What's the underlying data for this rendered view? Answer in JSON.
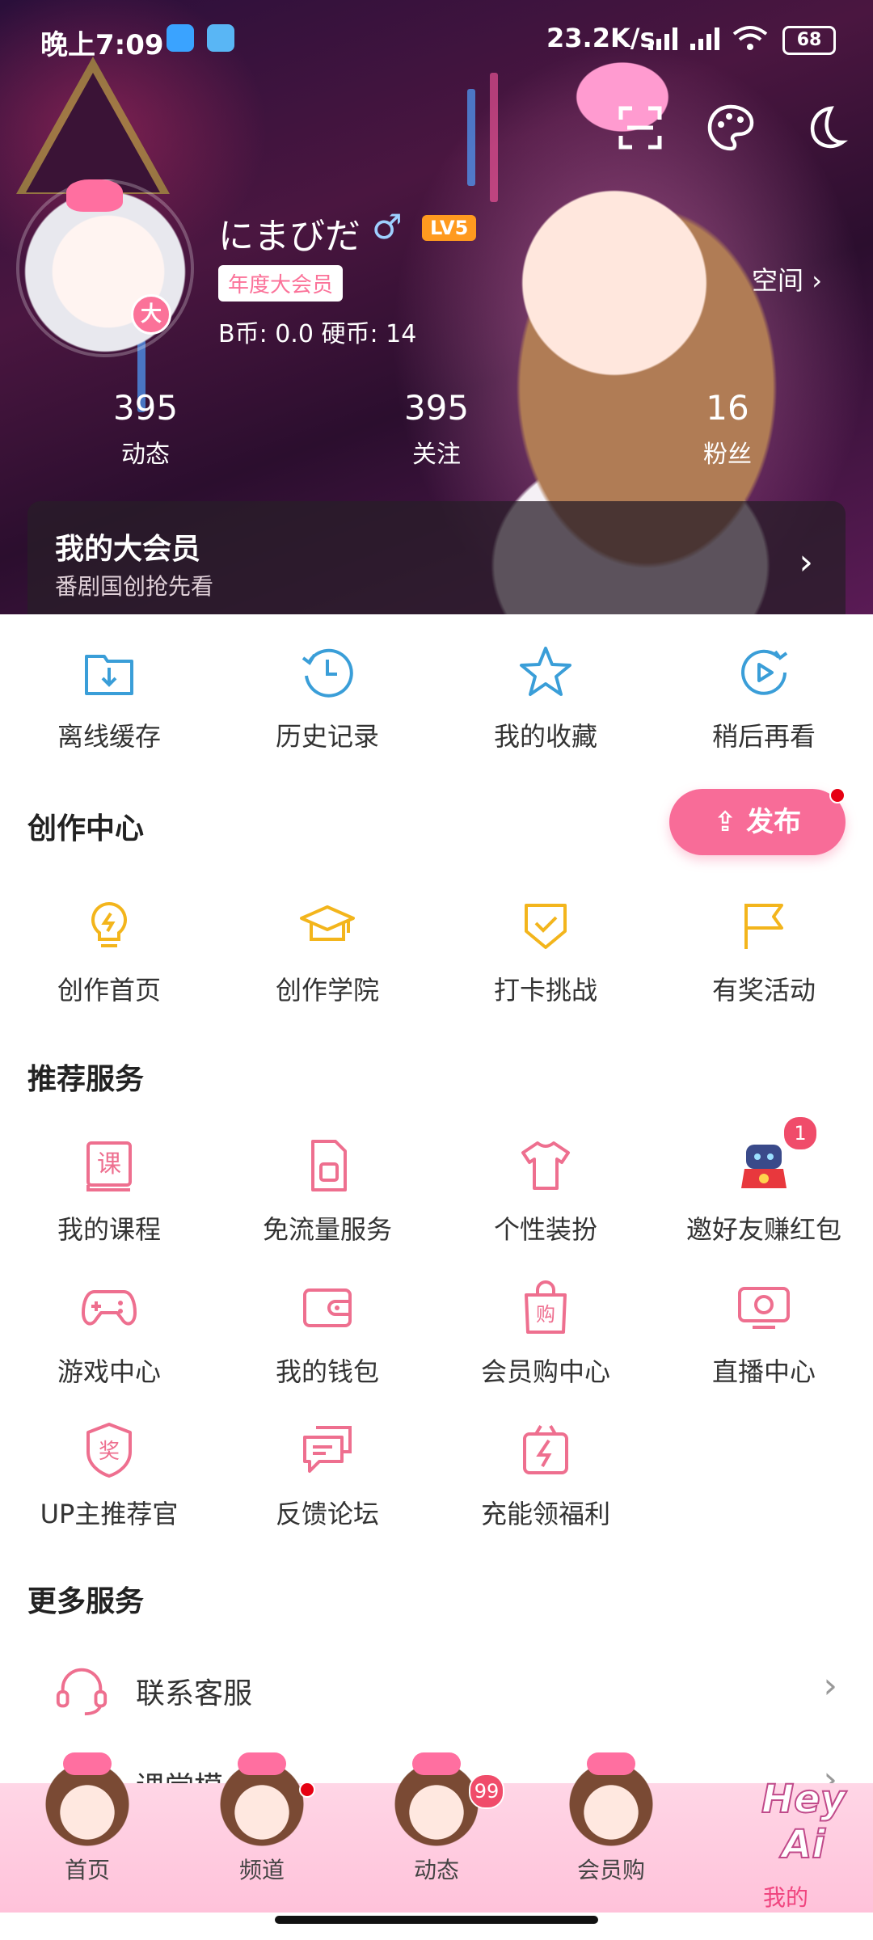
{
  "statusbar": {
    "time": "晚上7:09",
    "net": "23.2K/s",
    "battery": "68"
  },
  "profile": {
    "username": "にまびだ",
    "gender_symbol": "♂",
    "level": "LV5",
    "vip_tag": "年度大会员",
    "vip_badge": "大",
    "coins": "B币: 0.0   硬币: 14",
    "space_label": "空间",
    "stats": [
      {
        "value": "395",
        "label": "动态"
      },
      {
        "value": "395",
        "label": "关注"
      },
      {
        "value": "16",
        "label": "粉丝"
      }
    ]
  },
  "vip_card": {
    "title": "我的大会员",
    "subtitle": "番剧国创抢先看"
  },
  "quick_actions": [
    {
      "label": "离线缓存",
      "icon": "download-folder-icon"
    },
    {
      "label": "历史记录",
      "icon": "history-clock-icon"
    },
    {
      "label": "我的收藏",
      "icon": "star-icon"
    },
    {
      "label": "稍后再看",
      "icon": "watch-later-icon"
    }
  ],
  "creation": {
    "title": "创作中心",
    "publish_label": "发布",
    "items": [
      {
        "label": "创作首页",
        "icon": "lightbulb-icon"
      },
      {
        "label": "创作学院",
        "icon": "graduation-cap-icon"
      },
      {
        "label": "打卡挑战",
        "icon": "checkin-shield-icon"
      },
      {
        "label": "有奖活动",
        "icon": "flag-icon"
      }
    ]
  },
  "services": {
    "title": "推荐服务",
    "items": [
      {
        "label": "我的课程",
        "icon": "course-book-icon",
        "glyph": "课"
      },
      {
        "label": "免流量服务",
        "icon": "sim-card-icon"
      },
      {
        "label": "个性装扮",
        "icon": "tshirt-icon"
      },
      {
        "label": "邀好友赚红包",
        "icon": "mascot-redpacket-icon",
        "badge": "1"
      },
      {
        "label": "游戏中心",
        "icon": "gamepad-icon"
      },
      {
        "label": "我的钱包",
        "icon": "wallet-icon"
      },
      {
        "label": "会员购中心",
        "icon": "shopping-bag-icon",
        "glyph": "购"
      },
      {
        "label": "直播中心",
        "icon": "tv-icon"
      },
      {
        "label": "UP主推荐官",
        "icon": "award-badge-icon",
        "glyph": "奖"
      },
      {
        "label": "反馈论坛",
        "icon": "chat-bubbles-icon"
      },
      {
        "label": "充能领福利",
        "icon": "gift-bolt-icon"
      }
    ]
  },
  "more": {
    "title": "更多服务",
    "items": [
      {
        "label": "联系客服",
        "icon": "headset-icon"
      },
      {
        "label": "课堂模",
        "icon": "class-icon"
      }
    ]
  },
  "tabbar": {
    "tabs": [
      {
        "label": "首页"
      },
      {
        "label": "频道"
      },
      {
        "label": "动态",
        "badge": "99"
      },
      {
        "label": "会员购"
      },
      {
        "label": "我的"
      }
    ],
    "brand": "Hey Ai"
  },
  "colors": {
    "accent_pink": "#f86c98",
    "icon_blue": "#3a9ed8",
    "icon_yellow": "#f3b51c",
    "icon_pink": "#ee6f8f"
  }
}
